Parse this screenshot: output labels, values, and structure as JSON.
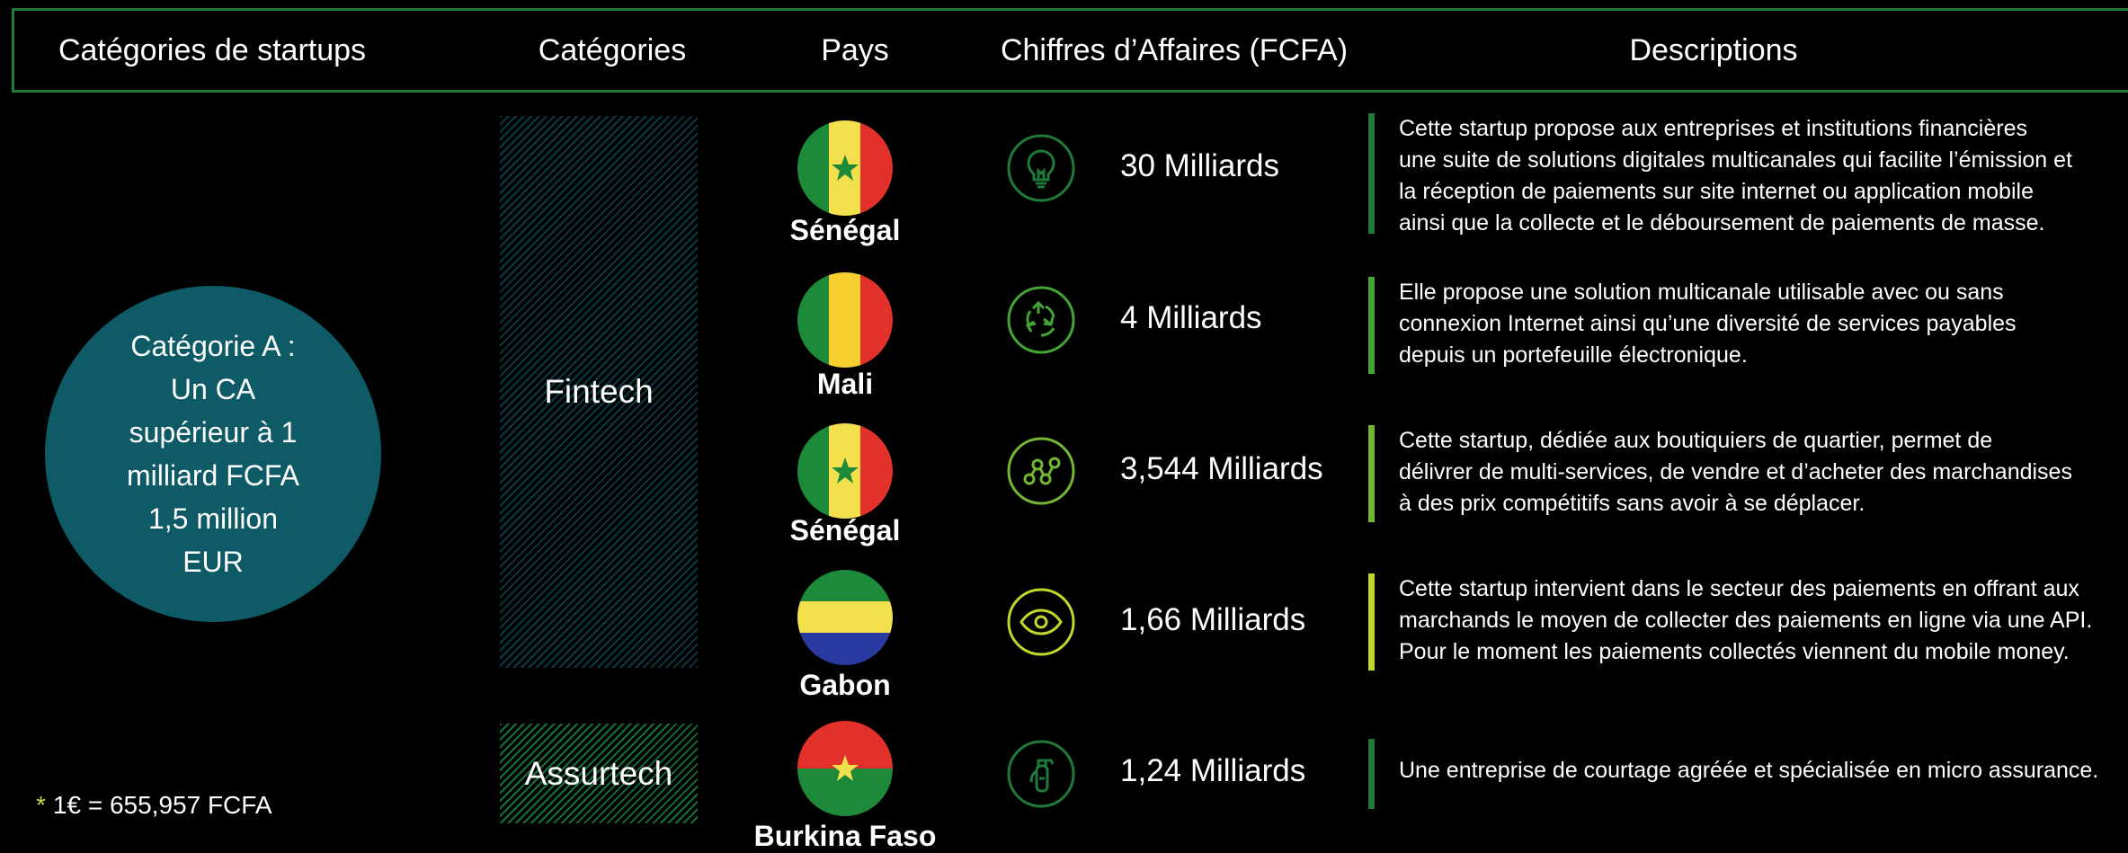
{
  "header": {
    "col_startups": "Catégories de startups",
    "col_categories": "Catégories",
    "col_pays": "Pays",
    "col_ca": "Chiffres d’Affaires (FCFA)",
    "col_descriptions": "Descriptions"
  },
  "category_a": {
    "lines": [
      "Catégorie A :",
      "Un CA",
      "supérieur à 1",
      "milliard FCFA",
      "1,5 million",
      "EUR"
    ]
  },
  "note": {
    "star": "*",
    "text": "1€ = 655,957 FCFA"
  },
  "categories": [
    {
      "label": "Fintech"
    },
    {
      "label": "Assurtech"
    }
  ],
  "rows": [
    {
      "country": "Sénégal",
      "flag": "senegal",
      "icon": "lightbulb-icon",
      "amount": "30 Milliards",
      "bar_color": "#1f7a3a",
      "description": "Cette startup propose aux entreprises et institutions financières une suite de solutions digitales multicanales qui facilite l’émission et la réception de paiements sur site internet ou application mobile ainsi que la collecte et le déboursement de paiements de masse.",
      "description_lines": [
        "Cette startup propose aux entreprises et institutions financières",
        "une suite de solutions digitales multicanales qui facilite l’émission et",
        "la réception de paiements sur site internet ou application mobile",
        "ainsi que la collecte et le déboursement de paiements de masse."
      ]
    },
    {
      "country": "Mali",
      "flag": "mali",
      "icon": "recycle-arrows-icon",
      "amount": "4 Milliards",
      "bar_color": "#43a534",
      "description_lines": [
        "Elle propose une solution multicanale utilisable avec ou sans",
        "connexion Internet ainsi qu’une diversité de services payables",
        "depuis un portefeuille électronique."
      ]
    },
    {
      "country": "Sénégal",
      "flag": "senegal",
      "icon": "network-nodes-icon",
      "amount": "3,544 Milliards",
      "bar_color": "#74b631",
      "description_lines": [
        "Cette startup, dédiée aux boutiquiers de quartier, permet de",
        "délivrer de multi-services, de vendre et d’acheter des marchandises",
        "à des prix compétitifs sans avoir à se déplacer."
      ]
    },
    {
      "country": "Gabon",
      "flag": "gabon",
      "icon": "eye-icon",
      "amount": "1,66 Milliards",
      "bar_color": "#c3d62a",
      "description_lines": [
        "Cette startup intervient dans le secteur des paiements en offrant aux",
        "marchands le moyen de collecter des paiements en ligne via une API.",
        "Pour le moment les paiements collectés viennent du mobile money."
      ]
    },
    {
      "country": "Burkina Faso",
      "flag": "burkina-faso",
      "icon": "fire-extinguisher-icon",
      "amount": "1,24 Milliards",
      "bar_color": "#1f7a3a",
      "description_lines": [
        "Une entreprise de courtage agréée et spécialisée en micro assurance."
      ]
    }
  ]
}
